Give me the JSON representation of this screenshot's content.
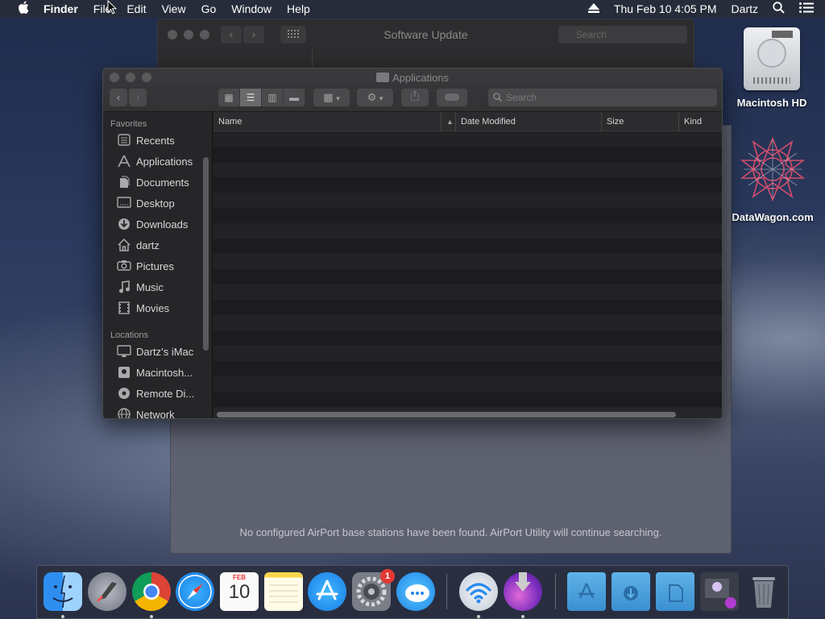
{
  "menubar": {
    "apple": "",
    "app": "Finder",
    "menus": [
      "File",
      "Edit",
      "View",
      "Go",
      "Window",
      "Help"
    ],
    "clock": "Thu Feb 10  4:05 PM",
    "user": "Dartz"
  },
  "desktop": {
    "icons": [
      {
        "label": "Macintosh HD"
      },
      {
        "label": "DataWagon.com"
      }
    ]
  },
  "software_update": {
    "title": "Software Update",
    "search_placeholder": "Search"
  },
  "airport": {
    "message": "No configured AirPort base stations have been found. AirPort Utility will continue searching."
  },
  "finder": {
    "title": "Applications",
    "search_placeholder": "Search",
    "sidebar": {
      "favorites_heading": "Favorites",
      "favorites": [
        {
          "label": "Recents",
          "icon": "recents-icon"
        },
        {
          "label": "Applications",
          "icon": "applications-icon"
        },
        {
          "label": "Documents",
          "icon": "documents-icon"
        },
        {
          "label": "Desktop",
          "icon": "desktop-icon"
        },
        {
          "label": "Downloads",
          "icon": "downloads-icon"
        },
        {
          "label": "dartz",
          "icon": "home-icon"
        },
        {
          "label": "Pictures",
          "icon": "pictures-icon"
        },
        {
          "label": "Music",
          "icon": "music-icon"
        },
        {
          "label": "Movies",
          "icon": "movies-icon"
        }
      ],
      "locations_heading": "Locations",
      "locations": [
        {
          "label": "Dartz’s iMac",
          "icon": "imac-icon"
        },
        {
          "label": "Macintosh...",
          "icon": "hard-drive-icon"
        },
        {
          "label": "Remote Di...",
          "icon": "remote-disc-icon"
        },
        {
          "label": "Network",
          "icon": "network-icon"
        }
      ]
    },
    "columns": {
      "name": "Name",
      "date_modified": "Date Modified",
      "size": "Size",
      "kind": "Kind"
    }
  },
  "dock": {
    "calendar_month": "FEB",
    "calendar_day": "10",
    "system_prefs_badge": "1"
  }
}
